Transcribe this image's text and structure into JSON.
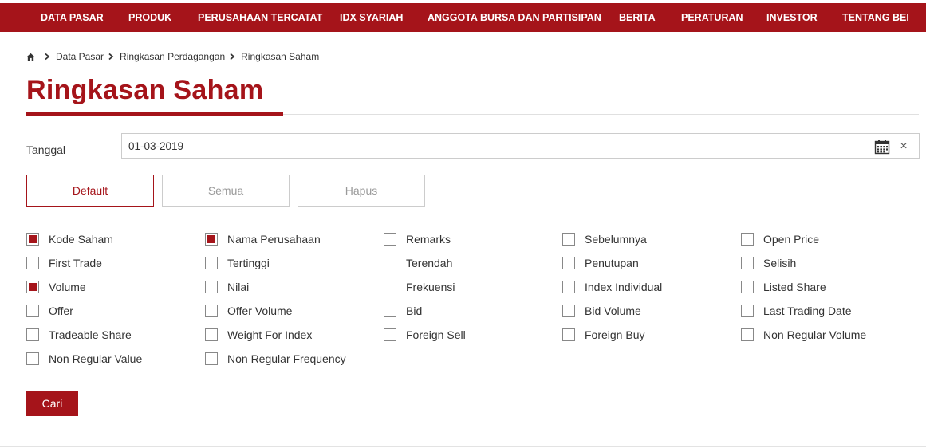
{
  "nav": {
    "items": [
      "DATA PASAR",
      "PRODUK",
      "PERUSAHAAN TERCATAT",
      "IDX SYARIAH",
      "ANGGOTA BURSA DAN PARTISIPAN",
      "BERITA",
      "PERATURAN",
      "INVESTOR",
      "TENTANG BEI"
    ]
  },
  "breadcrumb": {
    "home_icon": "home-icon",
    "items": [
      "Data Pasar",
      "Ringkasan Perdagangan",
      "Ringkasan Saham"
    ]
  },
  "page": {
    "title": "Ringkasan Saham"
  },
  "date_filter": {
    "label": "Tanggal",
    "value": "01-03-2019",
    "calendar_icon": "calendar-icon",
    "clear_label": "×"
  },
  "presets": {
    "default": "Default",
    "semua": "Semua",
    "hapus": "Hapus"
  },
  "columns": [
    {
      "label": "Kode Saham",
      "checked": true
    },
    {
      "label": "Nama Perusahaan",
      "checked": true
    },
    {
      "label": "Remarks",
      "checked": false
    },
    {
      "label": "Sebelumnya",
      "checked": false
    },
    {
      "label": "Open Price",
      "checked": false
    },
    {
      "label": "First Trade",
      "checked": false
    },
    {
      "label": "Tertinggi",
      "checked": false
    },
    {
      "label": "Terendah",
      "checked": false
    },
    {
      "label": "Penutupan",
      "checked": false
    },
    {
      "label": "Selisih",
      "checked": false
    },
    {
      "label": "Volume",
      "checked": true
    },
    {
      "label": "Nilai",
      "checked": false
    },
    {
      "label": "Frekuensi",
      "checked": false
    },
    {
      "label": "Index Individual",
      "checked": false
    },
    {
      "label": "Listed Share",
      "checked": false
    },
    {
      "label": "Offer",
      "checked": false
    },
    {
      "label": "Offer Volume",
      "checked": false
    },
    {
      "label": "Bid",
      "checked": false
    },
    {
      "label": "Bid Volume",
      "checked": false
    },
    {
      "label": "Last Trading Date",
      "checked": false
    },
    {
      "label": "Tradeable Share",
      "checked": false
    },
    {
      "label": "Weight For Index",
      "checked": false
    },
    {
      "label": "Foreign Sell",
      "checked": false
    },
    {
      "label": "Foreign Buy",
      "checked": false
    },
    {
      "label": "Non Regular Volume",
      "checked": false
    },
    {
      "label": "Non Regular Value",
      "checked": false
    },
    {
      "label": "Non Regular Frequency",
      "checked": false
    }
  ],
  "actions": {
    "search": "Cari"
  },
  "colors": {
    "brand": "#a5141a"
  }
}
